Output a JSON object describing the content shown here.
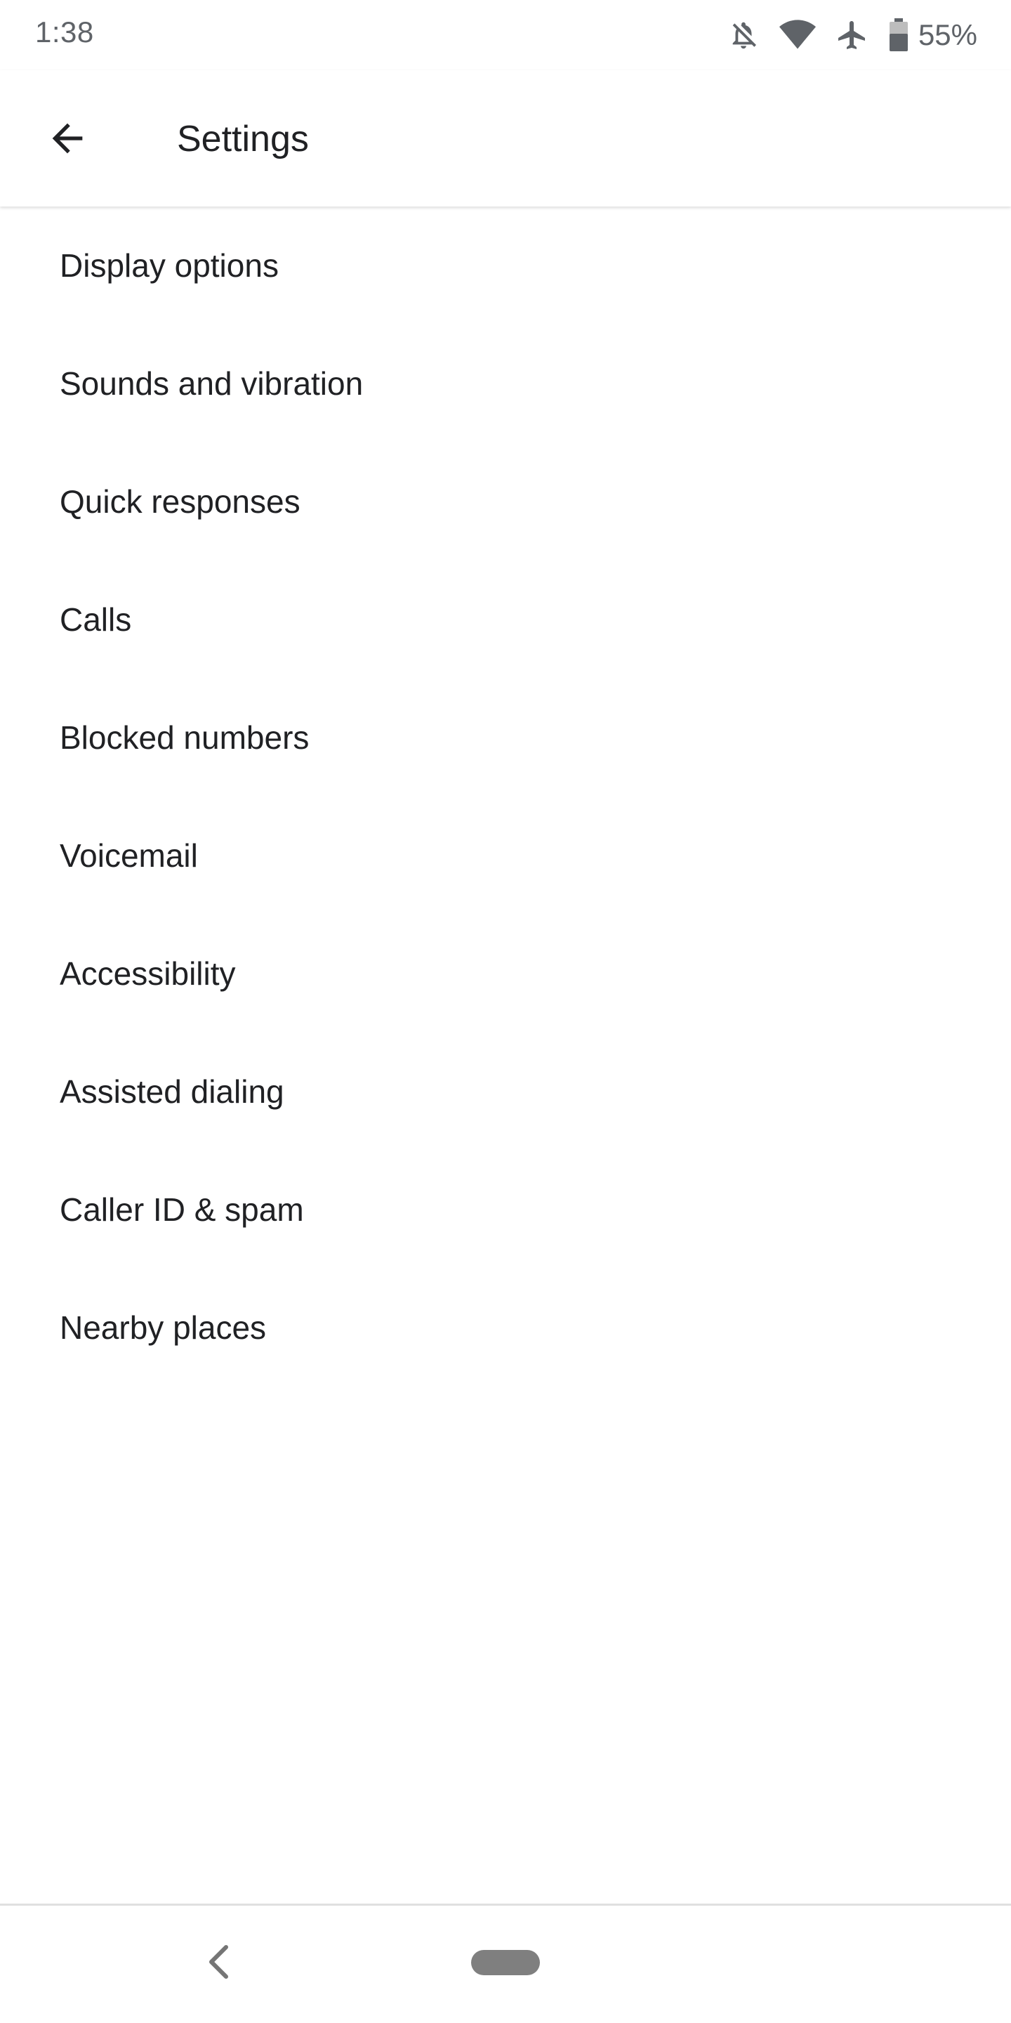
{
  "status_bar": {
    "time": "1:38",
    "battery": "55%",
    "icons": [
      "notifications-off-icon",
      "wifi-icon",
      "airplane-mode-icon",
      "battery-icon"
    ]
  },
  "app_bar": {
    "title": "Settings",
    "back_icon": "arrow-back-icon"
  },
  "settings": {
    "items": [
      {
        "label": "Display options"
      },
      {
        "label": "Sounds and vibration"
      },
      {
        "label": "Quick responses"
      },
      {
        "label": "Calls"
      },
      {
        "label": "Blocked numbers"
      },
      {
        "label": "Voicemail"
      },
      {
        "label": "Accessibility"
      },
      {
        "label": "Assisted dialing"
      },
      {
        "label": "Caller ID & spam"
      },
      {
        "label": "Nearby places"
      }
    ]
  },
  "nav_bar": {
    "icons": [
      "nav-back-icon",
      "home-pill-icon"
    ]
  },
  "colors": {
    "text_primary": "#202124",
    "text_secondary": "#5f6368",
    "background": "#ffffff"
  }
}
